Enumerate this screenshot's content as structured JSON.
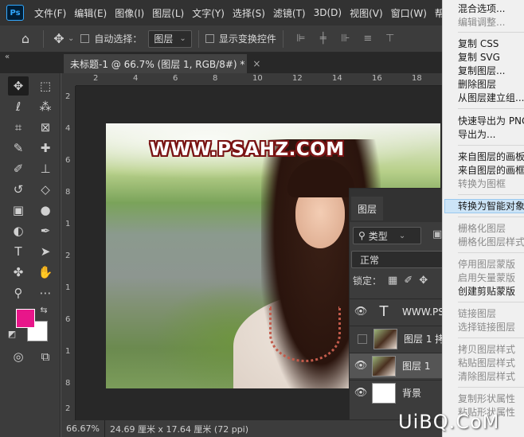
{
  "menubar": {
    "logo": "Ps",
    "items": [
      "文件(F)",
      "编辑(E)",
      "图像(I)",
      "图层(L)",
      "文字(Y)",
      "选择(S)",
      "滤镜(T)",
      "3D(D)",
      "视图(V)",
      "窗口(W)",
      "帮"
    ]
  },
  "options": {
    "auto_select_label": "自动选择：",
    "auto_select_value": "图层",
    "show_transform_label": "显示变换控件"
  },
  "document": {
    "tab_title": "未标题-1 @ 66.7% (图层 1, RGB/8#) *",
    "close_glyph": "×",
    "collapse_glyph": "«",
    "watermark_text": "WWW.PSAHZ.COM"
  },
  "rulers": {
    "top": [
      "2",
      "4",
      "6",
      "8",
      "10",
      "12",
      "14",
      "16",
      "18"
    ],
    "left": [
      "2",
      "4",
      "6",
      "8",
      "1",
      "2",
      "1",
      "6",
      "1",
      "8",
      "2"
    ]
  },
  "status": {
    "zoom": "66.67%",
    "dimensions": "24.69 厘米 x 17.64 厘米 (72 ppi)"
  },
  "colors": {
    "foreground": "#e8168a",
    "background": "#ffffff"
  },
  "layers_panel": {
    "tab": "图层",
    "filter_label": "类型",
    "blend_mode": "正常",
    "lock_label": "锁定：",
    "layers": [
      {
        "name": "WWW.PS",
        "kind": "text",
        "visible": true
      },
      {
        "name": "图层 1 拷",
        "kind": "image",
        "visible": false
      },
      {
        "name": "图层 1",
        "kind": "image",
        "visible": true,
        "selected": true
      },
      {
        "name": "背景",
        "kind": "white",
        "visible": true
      }
    ]
  },
  "context_menu": {
    "highlighted": "转换为智能对象",
    "items": [
      {
        "label": "混合选项...",
        "disabled": false
      },
      {
        "label": "编辑调整...",
        "disabled": true
      },
      {
        "label": "复制 CSS",
        "disabled": false
      },
      {
        "label": "复制 SVG",
        "disabled": false
      },
      {
        "label": "复制图层...",
        "disabled": false
      },
      {
        "label": "删除图层",
        "disabled": false
      },
      {
        "label": "从图层建立组...",
        "disabled": false
      },
      {
        "label": "快速导出为 PNG",
        "disabled": false
      },
      {
        "label": "导出为...",
        "disabled": false
      },
      {
        "label": "来自图层的画板...",
        "disabled": false
      },
      {
        "label": "来自图层的画框...",
        "disabled": false
      },
      {
        "label": "转换为图框",
        "disabled": true
      },
      {
        "label": "转换为智能对象",
        "disabled": false
      },
      {
        "label": "栅格化图层",
        "disabled": true
      },
      {
        "label": "栅格化图层样式",
        "disabled": true
      },
      {
        "label": "停用图层蒙版",
        "disabled": true
      },
      {
        "label": "启用矢量蒙版",
        "disabled": true
      },
      {
        "label": "创建剪贴蒙版",
        "disabled": false
      },
      {
        "label": "链接图层",
        "disabled": true
      },
      {
        "label": "选择链接图层",
        "disabled": true
      },
      {
        "label": "拷贝图层样式",
        "disabled": true
      },
      {
        "label": "粘贴图层样式",
        "disabled": true
      },
      {
        "label": "清除图层样式",
        "disabled": true
      },
      {
        "label": "复制形状属性",
        "disabled": true
      },
      {
        "label": "粘贴形状属性",
        "disabled": true
      }
    ]
  },
  "site_watermark": "UiBQ.CoM"
}
